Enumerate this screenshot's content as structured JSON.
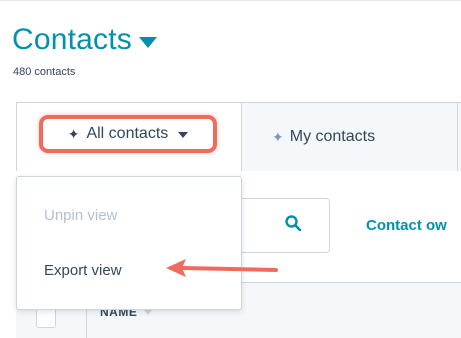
{
  "header": {
    "title": "Contacts",
    "count_text": "480 contacts"
  },
  "tabs": {
    "all_contacts": "All contacts",
    "my_contacts": "My contacts"
  },
  "dropdown": {
    "items": [
      {
        "label": "Unpin view",
        "state": "disabled"
      },
      {
        "label": "Export view",
        "state": "enabled"
      }
    ]
  },
  "filters": {
    "contact_owner": "Contact ow"
  },
  "table": {
    "columns": [
      "NAME"
    ]
  },
  "colors": {
    "accent": "#0091ae",
    "highlight": "#ee6c5f",
    "text": "#33475b",
    "disabled": "#b0c1d4",
    "border": "#cbd6e2"
  },
  "icons": [
    "caret-down-icon",
    "pin-icon",
    "search-icon",
    "arrow-left-icon",
    "sort-icon"
  ]
}
